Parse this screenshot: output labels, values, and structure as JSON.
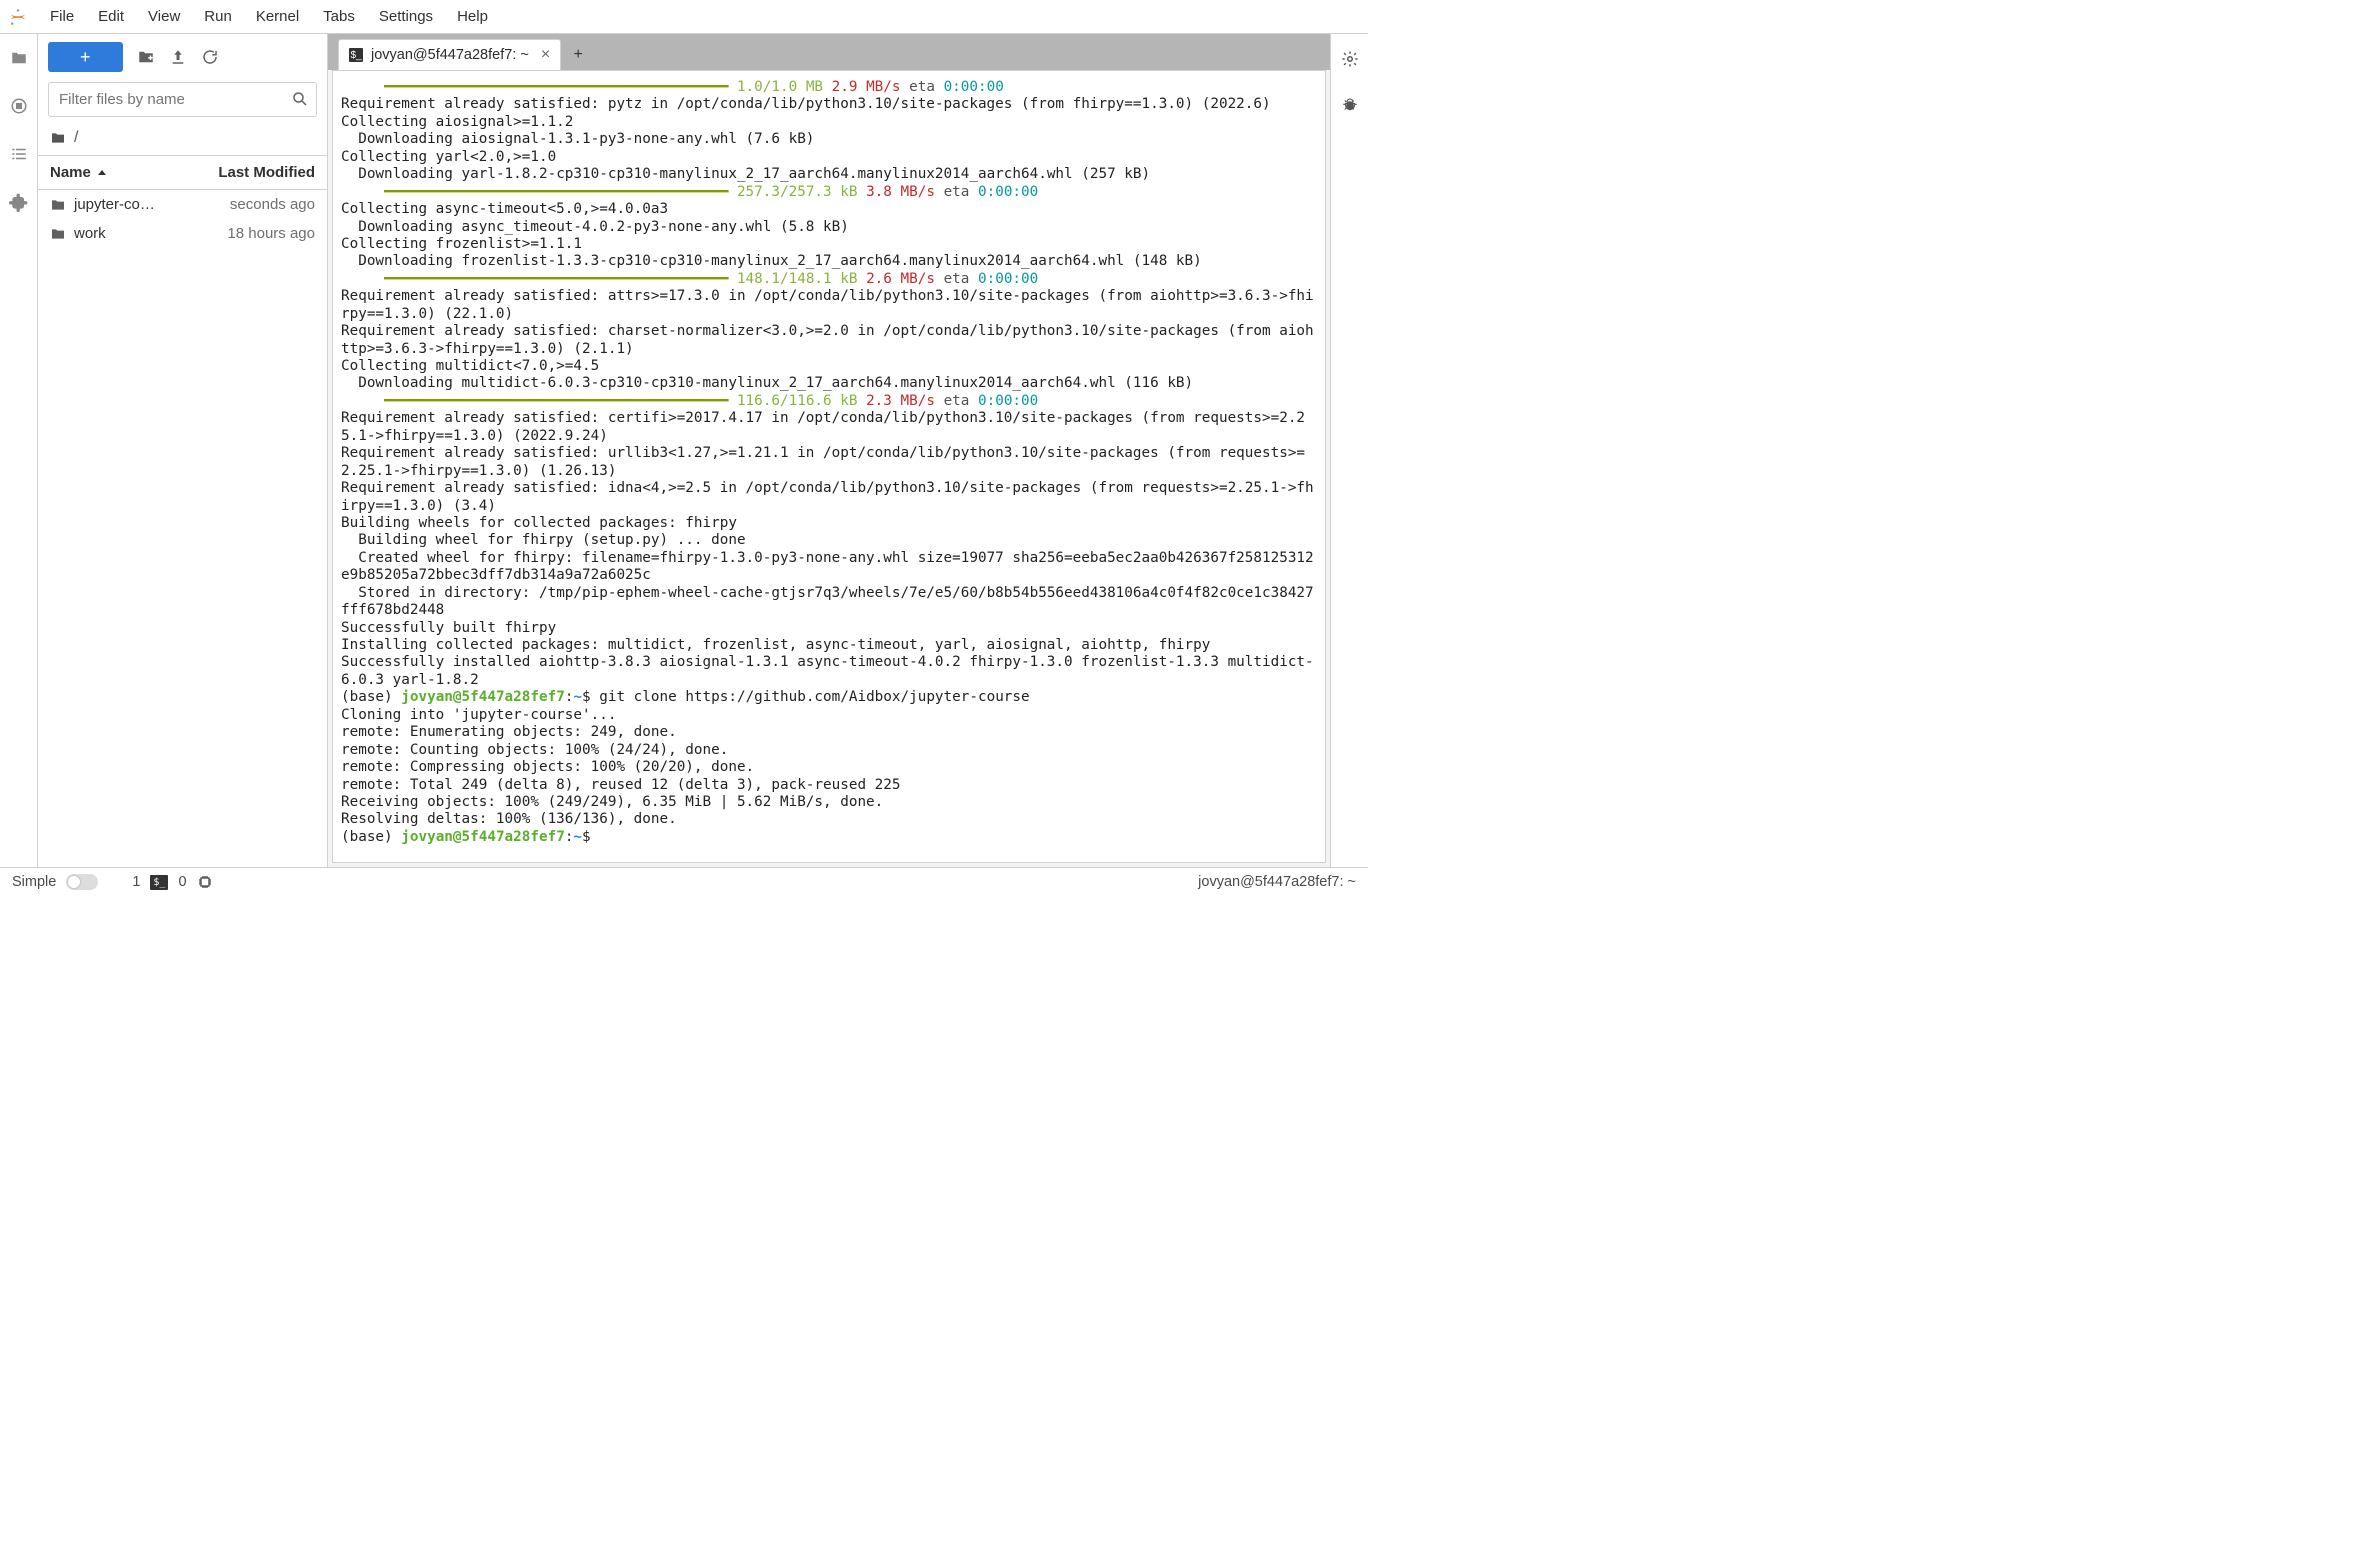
{
  "menubar": {
    "items": [
      "File",
      "Edit",
      "View",
      "Run",
      "Kernel",
      "Tabs",
      "Settings",
      "Help"
    ]
  },
  "activity": [
    "folder",
    "running",
    "list",
    "puzzle"
  ],
  "right_panel": [
    "sliders",
    "bug"
  ],
  "file_toolbar": {
    "search_placeholder": "Filter files by name",
    "breadcrumb": "/"
  },
  "file_table": {
    "headers": {
      "name": "Name",
      "modified": "Last Modified"
    },
    "rows": [
      {
        "icon": "folder",
        "name": "jupyter-co…",
        "modified": "seconds ago"
      },
      {
        "icon": "folder",
        "name": "work",
        "modified": "18 hours ago"
      }
    ]
  },
  "tab": {
    "label": "jovyan@5f447a28fef7: ~"
  },
  "terminal": {
    "lines": [
      {
        "type": "progress",
        "prog": "1.0/1.0 MB",
        "speed": "2.9 MB/s",
        "time": "0:00:00"
      },
      {
        "type": "plain",
        "text": "Requirement already satisfied: pytz in /opt/conda/lib/python3.10/site-packages (from fhirpy==1.3.0) (2022.6)"
      },
      {
        "type": "plain",
        "text": "Collecting aiosignal>=1.1.2"
      },
      {
        "type": "plain",
        "text": "  Downloading aiosignal-1.3.1-py3-none-any.whl (7.6 kB)"
      },
      {
        "type": "plain",
        "text": "Collecting yarl<2.0,>=1.0"
      },
      {
        "type": "plain",
        "text": "  Downloading yarl-1.8.2-cp310-cp310-manylinux_2_17_aarch64.manylinux2014_aarch64.whl (257 kB)"
      },
      {
        "type": "progress",
        "prog": "257.3/257.3 kB",
        "speed": "3.8 MB/s",
        "time": "0:00:00"
      },
      {
        "type": "plain",
        "text": "Collecting async-timeout<5.0,>=4.0.0a3"
      },
      {
        "type": "plain",
        "text": "  Downloading async_timeout-4.0.2-py3-none-any.whl (5.8 kB)"
      },
      {
        "type": "plain",
        "text": "Collecting frozenlist>=1.1.1"
      },
      {
        "type": "plain",
        "text": "  Downloading frozenlist-1.3.3-cp310-cp310-manylinux_2_17_aarch64.manylinux2014_aarch64.whl (148 kB)"
      },
      {
        "type": "progress",
        "prog": "148.1/148.1 kB",
        "speed": "2.6 MB/s",
        "time": "0:00:00"
      },
      {
        "type": "plain",
        "text": "Requirement already satisfied: attrs>=17.3.0 in /opt/conda/lib/python3.10/site-packages (from aiohttp>=3.6.3->fhirpy==1.3.0) (22.1.0)"
      },
      {
        "type": "plain",
        "text": "Requirement already satisfied: charset-normalizer<3.0,>=2.0 in /opt/conda/lib/python3.10/site-packages (from aiohttp>=3.6.3->fhirpy==1.3.0) (2.1.1)"
      },
      {
        "type": "plain",
        "text": "Collecting multidict<7.0,>=4.5"
      },
      {
        "type": "plain",
        "text": "  Downloading multidict-6.0.3-cp310-cp310-manylinux_2_17_aarch64.manylinux2014_aarch64.whl (116 kB)"
      },
      {
        "type": "progress",
        "prog": "116.6/116.6 kB",
        "speed": "2.3 MB/s",
        "time": "0:00:00"
      },
      {
        "type": "plain",
        "text": "Requirement already satisfied: certifi>=2017.4.17 in /opt/conda/lib/python3.10/site-packages (from requests>=2.25.1->fhirpy==1.3.0) (2022.9.24)"
      },
      {
        "type": "plain",
        "text": "Requirement already satisfied: urllib3<1.27,>=1.21.1 in /opt/conda/lib/python3.10/site-packages (from requests>=2.25.1->fhirpy==1.3.0) (1.26.13)"
      },
      {
        "type": "plain",
        "text": "Requirement already satisfied: idna<4,>=2.5 in /opt/conda/lib/python3.10/site-packages (from requests>=2.25.1->fhirpy==1.3.0) (3.4)"
      },
      {
        "type": "plain",
        "text": "Building wheels for collected packages: fhirpy"
      },
      {
        "type": "plain",
        "text": "  Building wheel for fhirpy (setup.py) ... done"
      },
      {
        "type": "plain",
        "text": "  Created wheel for fhirpy: filename=fhirpy-1.3.0-py3-none-any.whl size=19077 sha256=eeba5ec2aa0b426367f258125312e9b85205a72bbec3dff7db314a9a72a6025c"
      },
      {
        "type": "plain",
        "text": "  Stored in directory: /tmp/pip-ephem-wheel-cache-gtjsr7q3/wheels/7e/e5/60/b8b54b556eed438106a4c0f4f82c0ce1c38427fff678bd2448"
      },
      {
        "type": "plain",
        "text": "Successfully built fhirpy"
      },
      {
        "type": "plain",
        "text": "Installing collected packages: multidict, frozenlist, async-timeout, yarl, aiosignal, aiohttp, fhirpy"
      },
      {
        "type": "plain",
        "text": "Successfully installed aiohttp-3.8.3 aiosignal-1.3.1 async-timeout-4.0.2 fhirpy-1.3.0 frozenlist-1.3.3 multidict-6.0.3 yarl-1.8.2"
      },
      {
        "type": "prompt",
        "env": "(base) ",
        "user": "jovyan@5f447a28fef7",
        "path": "~",
        "cmd": "git clone https://github.com/Aidbox/jupyter-course"
      },
      {
        "type": "plain",
        "text": "Cloning into 'jupyter-course'..."
      },
      {
        "type": "plain",
        "text": "remote: Enumerating objects: 249, done."
      },
      {
        "type": "plain",
        "text": "remote: Counting objects: 100% (24/24), done."
      },
      {
        "type": "plain",
        "text": "remote: Compressing objects: 100% (20/20), done."
      },
      {
        "type": "plain",
        "text": "remote: Total 249 (delta 8), reused 12 (delta 3), pack-reused 225"
      },
      {
        "type": "plain",
        "text": "Receiving objects: 100% (249/249), 6.35 MiB | 5.62 MiB/s, done."
      },
      {
        "type": "plain",
        "text": "Resolving deltas: 100% (136/136), done."
      },
      {
        "type": "prompt",
        "env": "(base) ",
        "user": "jovyan@5f447a28fef7",
        "path": "~",
        "cmd": ""
      }
    ],
    "bar": "     ━━━━━━━━━━━━━━━━━━━━━━━━━━━━━━━━━━━━━━━━ ",
    "eta": "eta"
  },
  "status": {
    "simple": "Simple",
    "count1": "1",
    "count0": "0",
    "right": "jovyan@5f447a28fef7: ~"
  }
}
